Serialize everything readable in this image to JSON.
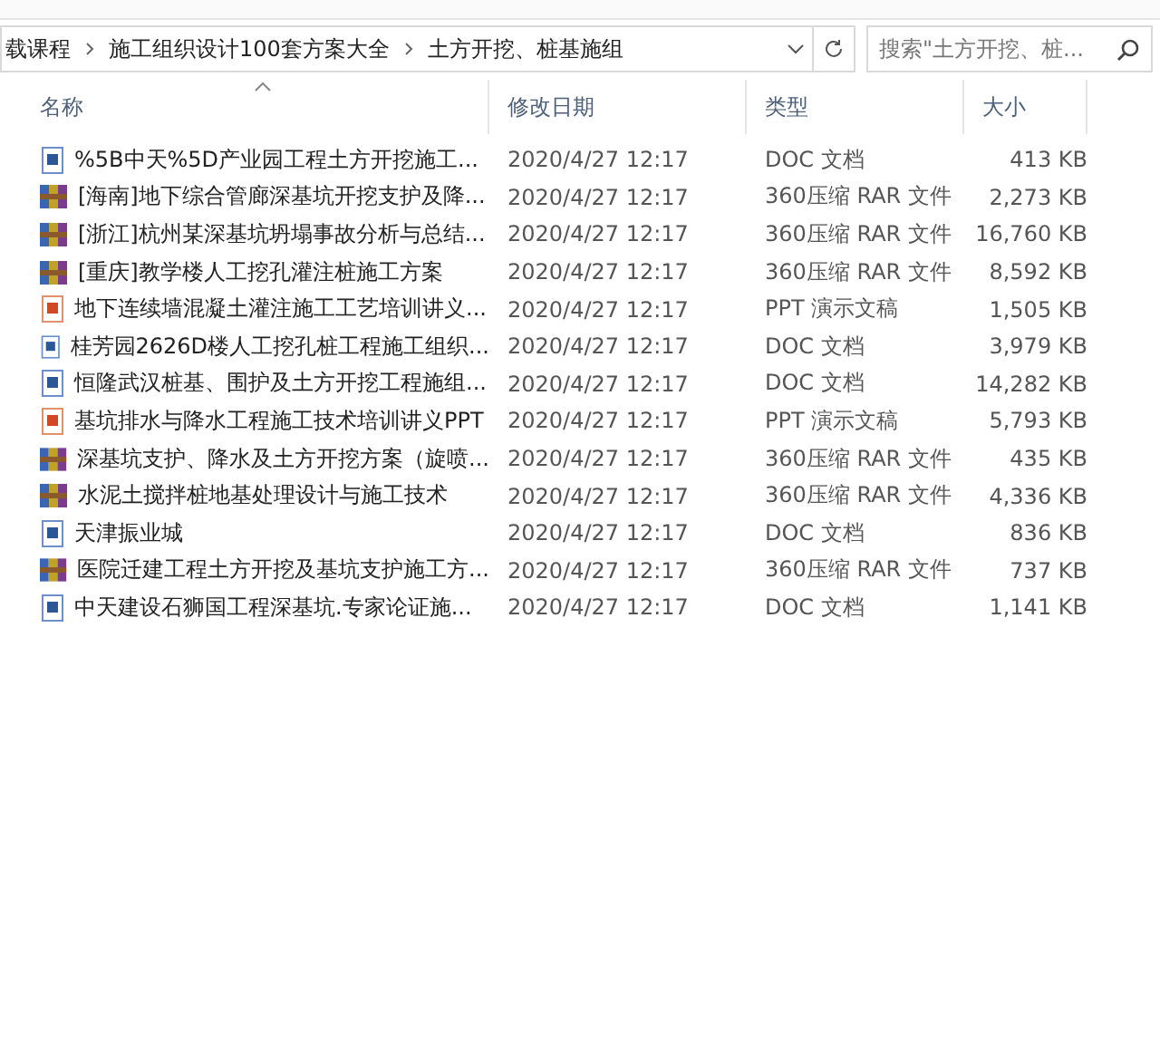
{
  "address_bar": {
    "crumbs": [
      "载课程",
      "施工组织设计100套方案大全",
      "土方开挖、桩基施组"
    ]
  },
  "search": {
    "placeholder": "搜索\"土方开挖、桩..."
  },
  "columns": [
    {
      "label": "名称",
      "sorted": true
    },
    {
      "label": "修改日期",
      "sorted": false
    },
    {
      "label": "类型",
      "sorted": false
    },
    {
      "label": "大小",
      "sorted": false
    }
  ],
  "files": [
    {
      "kind": "doc",
      "name": "%5B中天%5D产业园工程土方开挖施工...",
      "date": "2020/4/27 12:17",
      "type": "DOC 文档",
      "size": "413 KB"
    },
    {
      "kind": "rar",
      "name": "[海南]地下综合管廊深基坑开挖支护及降...",
      "date": "2020/4/27 12:17",
      "type": "360压缩 RAR 文件",
      "size": "2,273 KB"
    },
    {
      "kind": "rar",
      "name": "[浙江]杭州某深基坑坍塌事故分析与总结...",
      "date": "2020/4/27 12:17",
      "type": "360压缩 RAR 文件",
      "size": "16,760 KB"
    },
    {
      "kind": "rar",
      "name": "[重庆]教学楼人工挖孔灌注桩施工方案",
      "date": "2020/4/27 12:17",
      "type": "360压缩 RAR 文件",
      "size": "8,592 KB"
    },
    {
      "kind": "ppt",
      "name": "地下连续墙混凝土灌注施工工艺培训讲义...",
      "date": "2020/4/27 12:17",
      "type": "PPT 演示文稿",
      "size": "1,505 KB"
    },
    {
      "kind": "doc",
      "name": "桂芳园2626D楼人工挖孔桩工程施工组织...",
      "date": "2020/4/27 12:17",
      "type": "DOC 文档",
      "size": "3,979 KB"
    },
    {
      "kind": "doc",
      "name": "恒隆武汉桩基、围护及土方开挖工程施组...",
      "date": "2020/4/27 12:17",
      "type": "DOC 文档",
      "size": "14,282 KB"
    },
    {
      "kind": "ppt",
      "name": "基坑排水与降水工程施工技术培训讲义PPT",
      "date": "2020/4/27 12:17",
      "type": "PPT 演示文稿",
      "size": "5,793 KB"
    },
    {
      "kind": "rar",
      "name": "深基坑支护、降水及土方开挖方案（旋喷...",
      "date": "2020/4/27 12:17",
      "type": "360压缩 RAR 文件",
      "size": "435 KB"
    },
    {
      "kind": "rar",
      "name": "水泥土搅拌桩地基处理设计与施工技术",
      "date": "2020/4/27 12:17",
      "type": "360压缩 RAR 文件",
      "size": "4,336 KB"
    },
    {
      "kind": "doc",
      "name": "天津振业城",
      "date": "2020/4/27 12:17",
      "type": "DOC 文档",
      "size": "836 KB"
    },
    {
      "kind": "rar",
      "name": "医院迁建工程土方开挖及基坑支护施工方...",
      "date": "2020/4/27 12:17",
      "type": "360压缩 RAR 文件",
      "size": "737 KB"
    },
    {
      "kind": "doc",
      "name": "中天建设石狮国工程深基坑.专家论证施...",
      "date": "2020/4/27 12:17",
      "type": "DOC 文档",
      "size": "1,141 KB"
    }
  ]
}
